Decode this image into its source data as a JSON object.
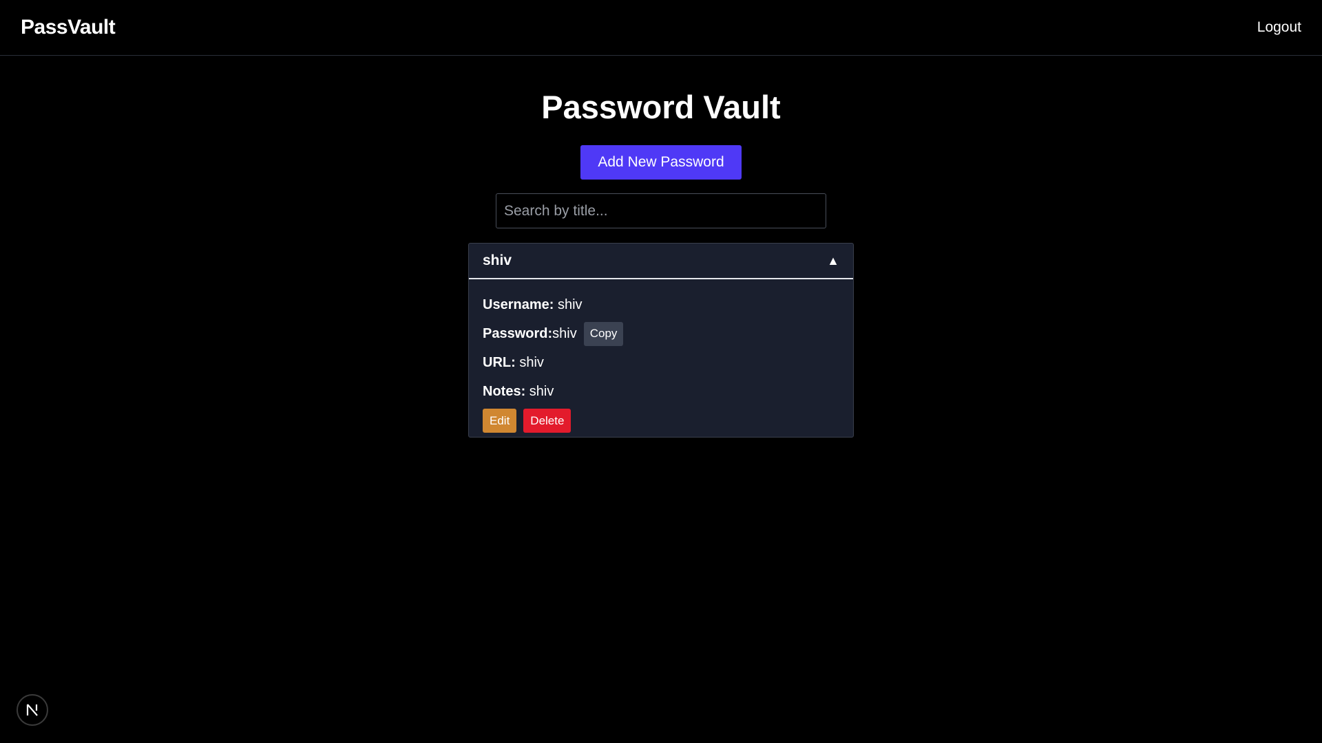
{
  "navbar": {
    "brand": "PassVault",
    "logout_label": "Logout"
  },
  "main": {
    "title": "Password Vault",
    "add_button_label": "Add New Password",
    "search": {
      "placeholder": "Search by title...",
      "value": ""
    }
  },
  "entries": [
    {
      "title": "shiv",
      "expanded": true,
      "chevron_icon": "triangle-up-icon",
      "username_label": "Username:",
      "username": "shiv",
      "password_label": "Password:",
      "password": "shiv",
      "copy_label": "Copy",
      "url_label": "URL:",
      "url": "shiv",
      "notes_label": "Notes:",
      "notes": "shiv",
      "edit_label": "Edit",
      "delete_label": "Delete"
    }
  ],
  "chevron_glyph": "▲",
  "dev_badge": {
    "icon": "nextjs-logo-icon"
  },
  "colors": {
    "background": "#000000",
    "accent": "#4f39f6",
    "card": "#1a1f2e",
    "edit": "#d08731",
    "delete": "#e31b2c",
    "copy": "#3b4252"
  }
}
